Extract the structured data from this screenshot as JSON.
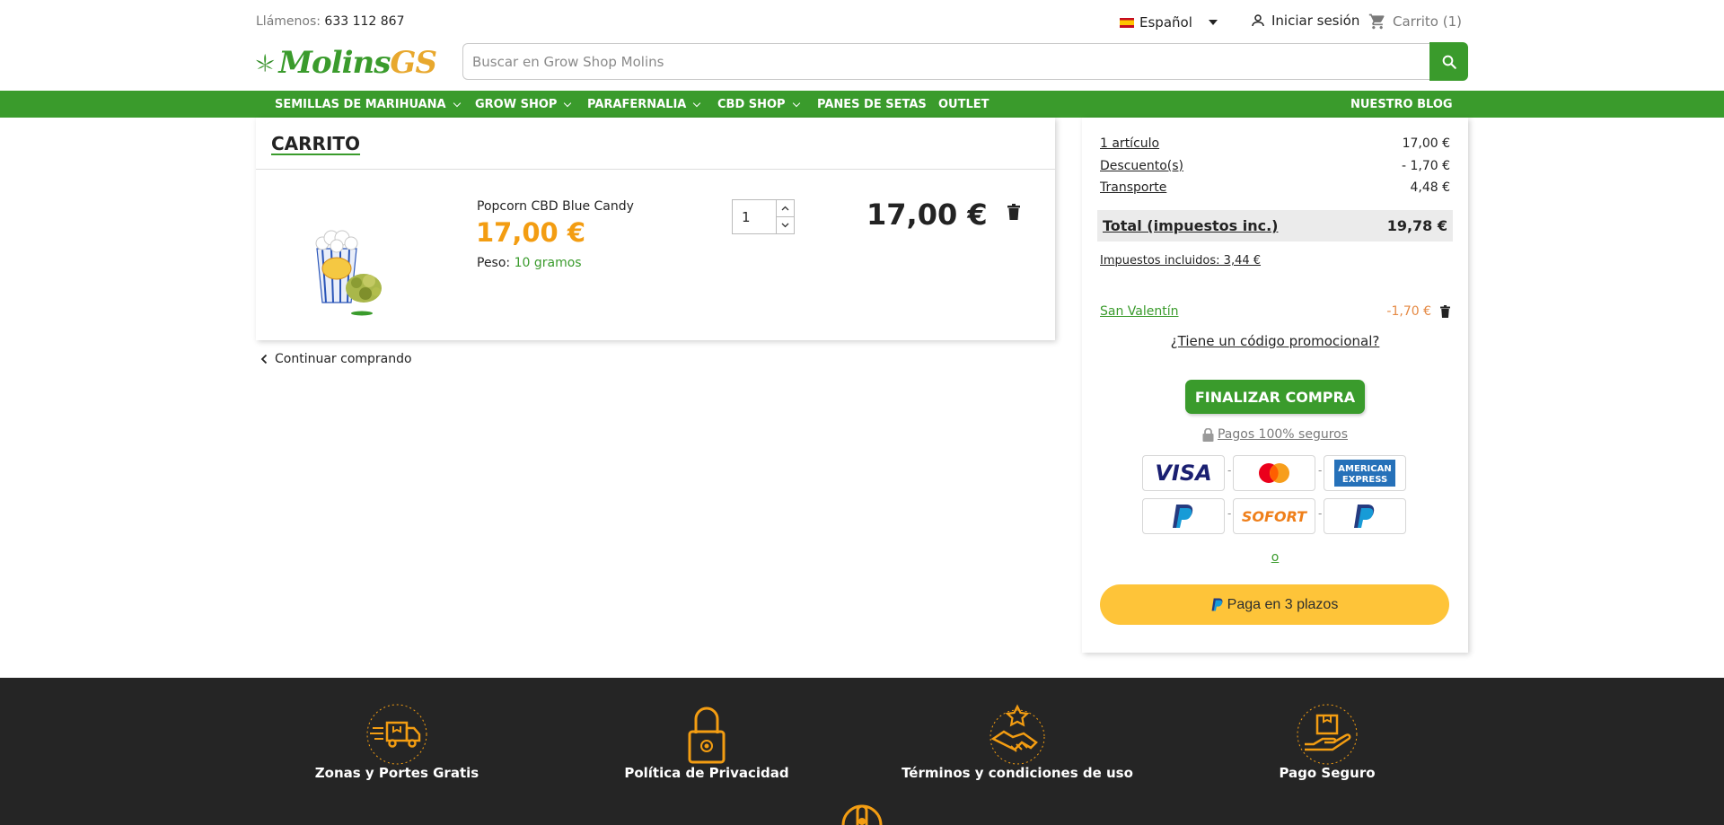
{
  "header": {
    "phone_label": "Llámenos:",
    "phone_number": "633 112 867",
    "language": "Español",
    "signin_label": "Iniciar sesión",
    "cart_label": "Carrito (1)",
    "logo_main": "Molins",
    "logo_accent": "GS",
    "search_placeholder": "Buscar en Grow Shop Molins"
  },
  "nav": {
    "items": [
      {
        "label": "SEMILLAS DE MARIHUANA",
        "has_dropdown": true
      },
      {
        "label": "GROW SHOP",
        "has_dropdown": true
      },
      {
        "label": "PARAFERNALIA",
        "has_dropdown": true
      },
      {
        "label": "CBD SHOP",
        "has_dropdown": true
      },
      {
        "label": "PANES DE SETAS",
        "has_dropdown": false
      },
      {
        "label": "OUTLET",
        "has_dropdown": false
      }
    ],
    "blog": "NUESTRO BLOG"
  },
  "cart": {
    "title": "CARRITO",
    "item": {
      "name": "Popcorn CBD Blue Candy",
      "price": "17,00 €",
      "weight_label": "Peso:",
      "weight_value": "10 gramos",
      "quantity": "1",
      "line_total": "17,00 €"
    },
    "continue_label": "Continuar comprando"
  },
  "summary": {
    "items_label": "1 artículo",
    "items_value": "17,00 €",
    "discount_label": "Descuento(s)",
    "discount_value": "- 1,70 €",
    "shipping_label": "Transporte",
    "shipping_value": "4,48 €",
    "total_label": "Total (impuestos inc.)",
    "total_value": "19,78 €",
    "tax_note": "Impuestos incluidos: 3,44 €",
    "voucher_label": "San Valentín",
    "voucher_value": "-1,70 €",
    "promo_label": "¿Tiene un código promocional?",
    "checkout_label": "FINALIZAR COMPRA",
    "secure_label": "Pagos 100% seguros",
    "payment_methods": [
      "VISA",
      "Mastercard",
      "AMERICAN EXPRESS",
      "PayPal",
      "SOFORT",
      "PayPal"
    ],
    "or_label": "o",
    "paypal_label": "Paga en 3 plazos"
  },
  "footer": {
    "features": [
      {
        "label": "Zonas y Portes Gratis",
        "icon": "delivery-truck-icon"
      },
      {
        "label": "Política de Privacidad",
        "icon": "padlock-icon"
      },
      {
        "label": "Términos y condiciones de uso",
        "icon": "handshake-icon"
      },
      {
        "label": "Pago Seguro",
        "icon": "secure-payment-icon"
      }
    ]
  },
  "colors": {
    "brand_green": "#3a9b2c",
    "price_orange": "#f39d12",
    "footer_bg": "#252525",
    "footer_icon": "#f39d12",
    "paypal_yellow": "#fec439"
  }
}
